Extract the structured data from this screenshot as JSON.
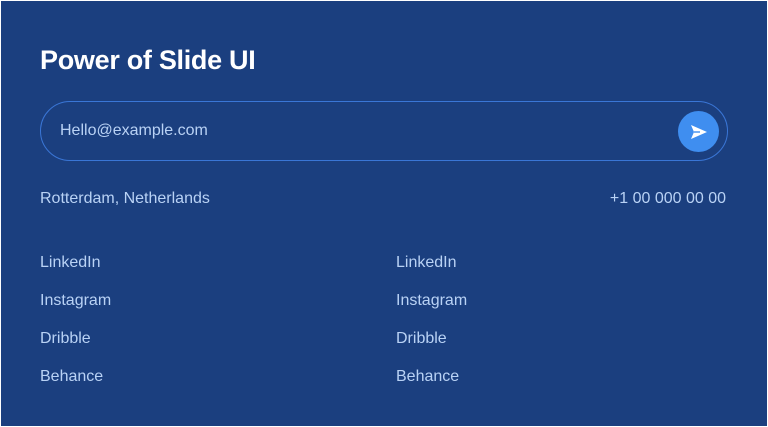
{
  "heading": {
    "title": "Power of Slide UI"
  },
  "subscribe": {
    "email_placeholder": "Hello@example.com",
    "send_icon": "send-arrow-icon"
  },
  "contact": {
    "location": "Rotterdam, Netherlands",
    "phone": "+1 00 000 00 00"
  },
  "links": {
    "left": [
      {
        "label": "LinkedIn"
      },
      {
        "label": "Instagram"
      },
      {
        "label": "Dribble"
      },
      {
        "label": "Behance"
      }
    ],
    "right": [
      {
        "label": "LinkedIn"
      },
      {
        "label": "Instagram"
      },
      {
        "label": "Dribble"
      },
      {
        "label": "Behance"
      }
    ]
  },
  "colors": {
    "background": "#1b3f7f",
    "accent": "#3f8ef0",
    "text_muted": "#b9d2f5",
    "border": "#3a76d6"
  }
}
